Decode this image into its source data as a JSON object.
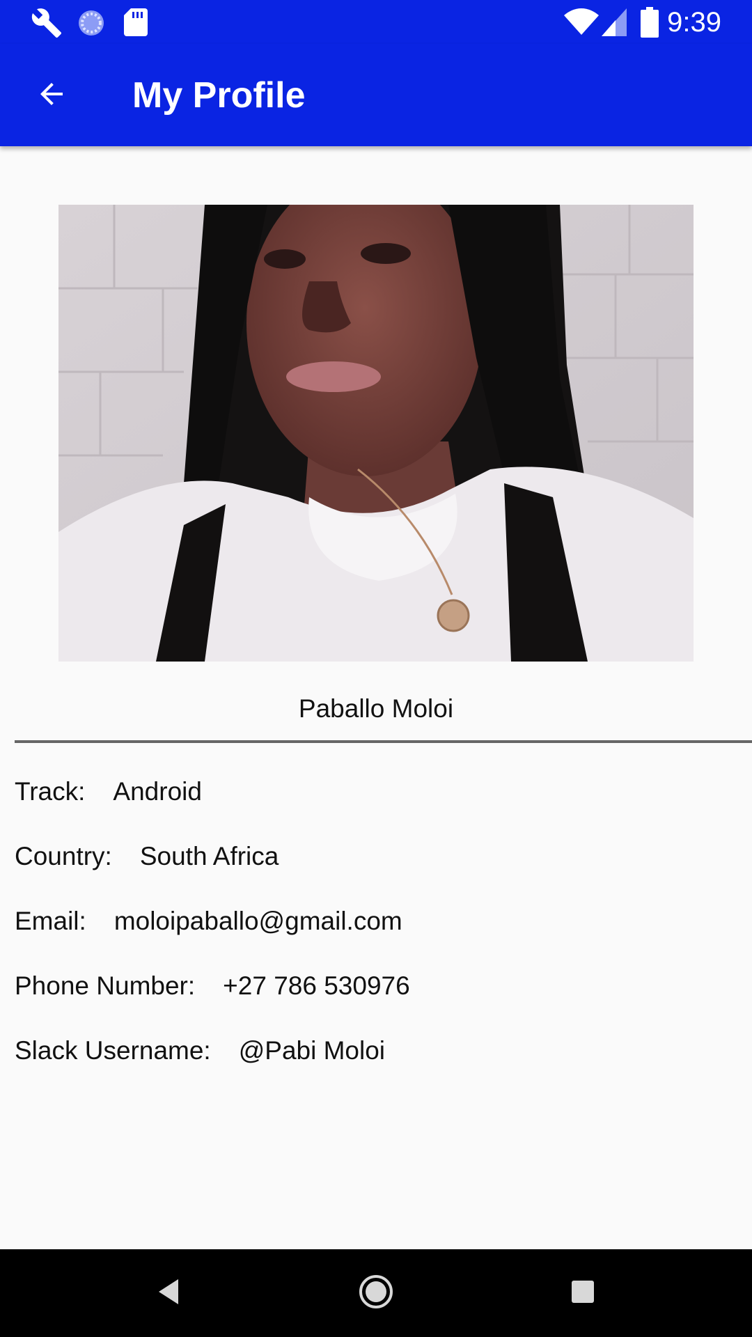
{
  "status_bar": {
    "time": "9:39",
    "left_icons": [
      "wrench-icon",
      "sync-icon",
      "sd-card-icon"
    ],
    "right_icons": [
      "wifi-icon",
      "cellular-signal-icon",
      "battery-icon"
    ]
  },
  "app_bar": {
    "title": "My Profile",
    "back_icon": "arrow-back-icon",
    "color": "#0a24e3"
  },
  "profile": {
    "name": "Paballo Moloi",
    "photo": "profile-photo"
  },
  "details": [
    {
      "label": "Track:",
      "value": "Android"
    },
    {
      "label": "Country:",
      "value": "South Africa"
    },
    {
      "label": "Email:",
      "value": "moloipaballo@gmail.com"
    },
    {
      "label": "Phone Number:",
      "value": "+27 786 530976"
    },
    {
      "label": "Slack Username:",
      "value": "@Pabi Moloi"
    }
  ],
  "nav_bar": {
    "buttons": [
      "nav-back-icon",
      "nav-home-icon",
      "nav-recents-icon"
    ]
  }
}
